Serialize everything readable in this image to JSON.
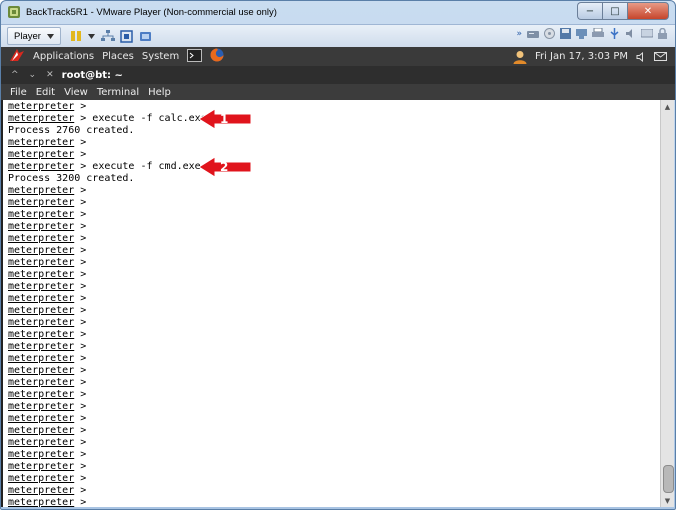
{
  "window": {
    "title": "BackTrack5R1 - VMware Player (Non-commercial use only)",
    "min_glyph": "−",
    "max_glyph": "□",
    "close_glyph": "✕"
  },
  "vmware_toolbar": {
    "player_label": "Player"
  },
  "gnome_panel": {
    "menus": [
      "Applications",
      "Places",
      "System"
    ],
    "clock": "Fri Jan 17,  3:03 PM"
  },
  "terminal_window": {
    "title": "root@bt: ~",
    "menu": [
      "File",
      "Edit",
      "View",
      "Terminal",
      "Help"
    ]
  },
  "terminal": {
    "prompt": "meterpreter",
    "lines": [
      {
        "prompt": true,
        "text": " >"
      },
      {
        "prompt": true,
        "text": " > execute -f calc.exe"
      },
      {
        "prompt": false,
        "text": "Process 2760 created."
      },
      {
        "prompt": true,
        "text": " >"
      },
      {
        "prompt": true,
        "text": " >"
      },
      {
        "prompt": true,
        "text": " > execute -f cmd.exe"
      },
      {
        "prompt": false,
        "text": "Process 3200 created."
      },
      {
        "prompt": true,
        "text": " >"
      },
      {
        "prompt": true,
        "text": " >"
      },
      {
        "prompt": true,
        "text": " >"
      },
      {
        "prompt": true,
        "text": " >"
      },
      {
        "prompt": true,
        "text": " >"
      },
      {
        "prompt": true,
        "text": " >"
      },
      {
        "prompt": true,
        "text": " >"
      },
      {
        "prompt": true,
        "text": " >"
      },
      {
        "prompt": true,
        "text": " >"
      },
      {
        "prompt": true,
        "text": " >"
      },
      {
        "prompt": true,
        "text": " >"
      },
      {
        "prompt": true,
        "text": " >"
      },
      {
        "prompt": true,
        "text": " >"
      },
      {
        "prompt": true,
        "text": " >"
      },
      {
        "prompt": true,
        "text": " >"
      },
      {
        "prompt": true,
        "text": " >"
      },
      {
        "prompt": true,
        "text": " >"
      },
      {
        "prompt": true,
        "text": " >"
      },
      {
        "prompt": true,
        "text": " >"
      },
      {
        "prompt": true,
        "text": " >"
      },
      {
        "prompt": true,
        "text": " >"
      },
      {
        "prompt": true,
        "text": " >"
      },
      {
        "prompt": true,
        "text": " >"
      },
      {
        "prompt": true,
        "text": " >"
      },
      {
        "prompt": true,
        "text": " >"
      },
      {
        "prompt": true,
        "text": " >"
      },
      {
        "prompt": true,
        "text": " >"
      },
      {
        "prompt": true,
        "text": " >"
      }
    ]
  },
  "annotations": [
    {
      "label": "1",
      "line": 1
    },
    {
      "label": "2",
      "line": 5
    }
  ],
  "colors": {
    "annotation_red": "#e0141c",
    "gnome_panel": "#3a3a3a",
    "terminal_bg": "#ffffff"
  }
}
